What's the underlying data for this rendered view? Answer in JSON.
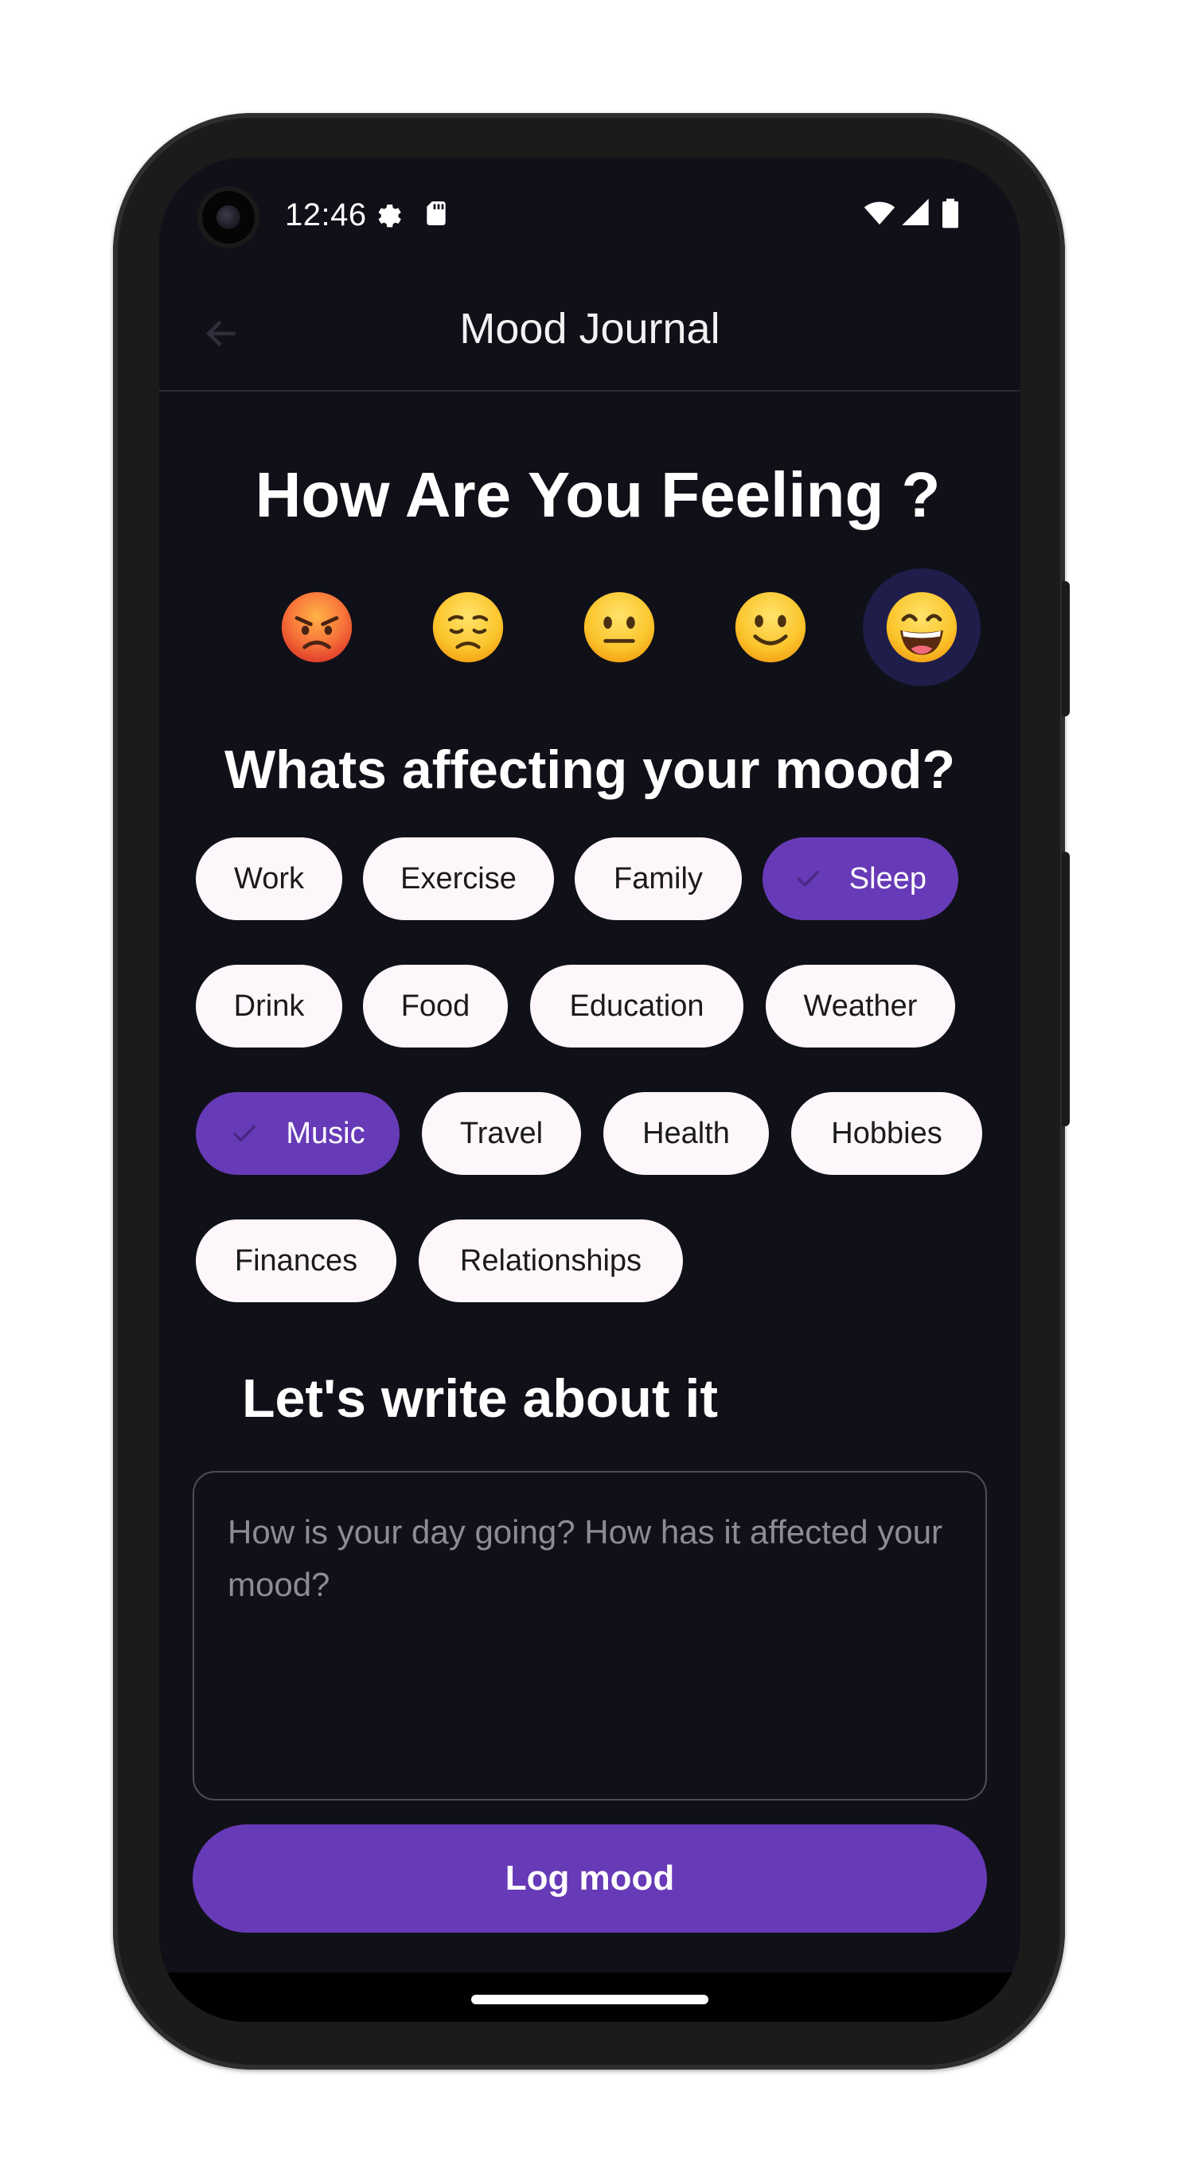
{
  "status_bar": {
    "time": "12:46",
    "icons": [
      "settings-gear-icon",
      "sd-card-icon",
      "wifi-icon",
      "cell-signal-icon",
      "battery-icon"
    ]
  },
  "app_bar": {
    "title": "Mood Journal",
    "back_icon": "arrow-left-icon"
  },
  "mood": {
    "title": "How Are You Feeling ?",
    "options": [
      {
        "name": "angry",
        "emoji": "😡",
        "selected": false
      },
      {
        "name": "sad",
        "emoji": "😞",
        "selected": false
      },
      {
        "name": "neutral",
        "emoji": "😐",
        "selected": false
      },
      {
        "name": "slightly-happy",
        "emoji": "🙂",
        "selected": false
      },
      {
        "name": "happy",
        "emoji": "😄",
        "selected": true
      }
    ]
  },
  "factors": {
    "title": "Whats affecting your mood?",
    "chips": [
      {
        "label": "Work",
        "selected": false
      },
      {
        "label": "Exercise",
        "selected": false
      },
      {
        "label": "Family",
        "selected": false
      },
      {
        "label": "Sleep",
        "selected": true
      },
      {
        "label": "Drink",
        "selected": false
      },
      {
        "label": "Food",
        "selected": false
      },
      {
        "label": "Education",
        "selected": false
      },
      {
        "label": "Weather",
        "selected": false
      },
      {
        "label": "Music",
        "selected": true
      },
      {
        "label": "Travel",
        "selected": false
      },
      {
        "label": "Health",
        "selected": false
      },
      {
        "label": "Hobbies",
        "selected": false
      },
      {
        "label": "Finances",
        "selected": false
      },
      {
        "label": "Relationships",
        "selected": false
      }
    ]
  },
  "journal": {
    "title": "Let's write about it",
    "placeholder": "How is your day going? How has it affected your mood?",
    "value": ""
  },
  "submit": {
    "label": "Log mood"
  },
  "colors": {
    "background": "#101018",
    "accent": "#673ab7",
    "chip_background": "#fdf6fb",
    "selected_emoji_background": "#1f1d4a"
  }
}
